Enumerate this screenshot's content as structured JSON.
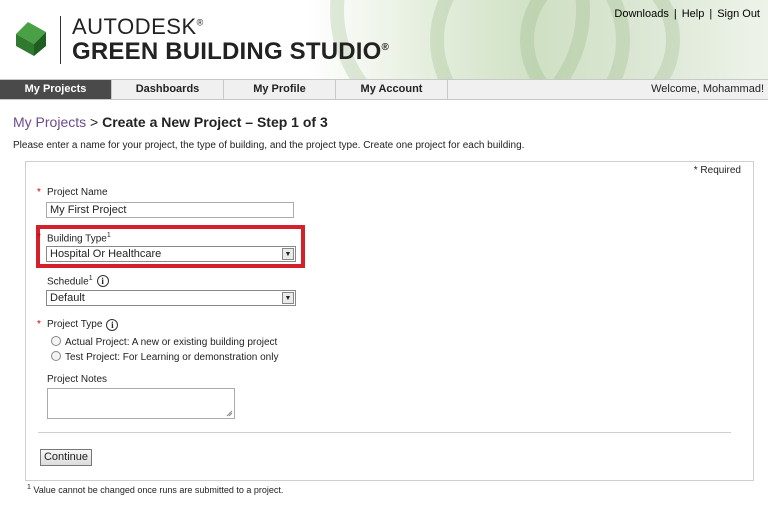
{
  "header": {
    "brand_line1": "AUTODESK",
    "brand_line2": "GREEN BUILDING STUDIO",
    "reg_mark": "®",
    "links": [
      "Downloads",
      "Help",
      "Sign Out"
    ]
  },
  "nav": {
    "tabs": [
      {
        "label": "My Projects",
        "active": true
      },
      {
        "label": "Dashboards",
        "active": false
      },
      {
        "label": "My Profile",
        "active": false
      },
      {
        "label": "My Account",
        "active": false
      }
    ],
    "welcome": "Welcome, Mohammad!"
  },
  "page": {
    "breadcrumb_link": "My Projects",
    "breadcrumb_sep": " > ",
    "title": "Create a New Project – Step 1 of 3",
    "intro": "Please enter a name for your project, the type of building, and the project type. Create one project for each building."
  },
  "form": {
    "required_note": "* Required",
    "project_name_label": "Project Name",
    "project_name_value": "My First Project",
    "building_type_label": "Building Type",
    "building_type_value": "Hospital Or Healthcare",
    "schedule_label": "Schedule",
    "schedule_value": "Default",
    "project_type_label": "Project Type",
    "radio_options": [
      "Actual Project: A new or existing building project",
      "Test Project: For Learning or demonstration only"
    ],
    "project_notes_label": "Project Notes",
    "continue_label": "Continue",
    "footnote_mark": "1",
    "footnote": "Value cannot be changed once runs are submitted to a project.",
    "star": "*",
    "info_glyph": "i"
  },
  "colors": {
    "accent_red": "#d3202a",
    "nav_active": "#4a4a4a",
    "link_purple": "#6e4a8a",
    "logo_green": "#3f8f3a"
  },
  "icons": [
    "autodesk-logo-icon",
    "info-icon",
    "dropdown-arrow-icon"
  ]
}
